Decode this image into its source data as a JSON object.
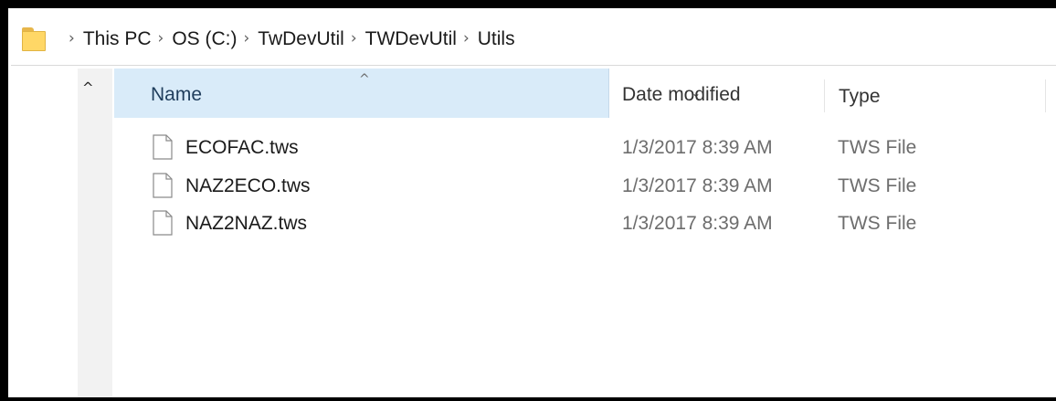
{
  "breadcrumbs": [
    "This PC",
    "OS (C:)",
    "TwDevUtil",
    "TWDevUtil",
    "Utils"
  ],
  "icons": {
    "folder": "folder-icon",
    "separator": "chevron-right-icon",
    "file": "file-icon",
    "sort": "sort-ascending-icon",
    "dropdown": "chevron-down-icon",
    "collapse": "chevron-up-icon"
  },
  "glyphs": {
    "separator": "›",
    "sort": "^",
    "dropdown": "⌄",
    "collapse": "^"
  },
  "columns": {
    "name": "Name",
    "date_modified": "Date modified",
    "type": "Type"
  },
  "files": [
    {
      "name": "ECOFAC.tws",
      "date_modified": "1/3/2017 8:39 AM",
      "type": "TWS File"
    },
    {
      "name": "NAZ2ECO.tws",
      "date_modified": "1/3/2017 8:39 AM",
      "type": "TWS File"
    },
    {
      "name": "NAZ2NAZ.tws",
      "date_modified": "1/3/2017 8:39 AM",
      "type": "TWS File"
    }
  ],
  "colors": {
    "header_highlight": "#d9ebf9",
    "nav_pane": "#f2f2f2",
    "folder_yellow": "#ffd766",
    "frame": "#000000"
  }
}
